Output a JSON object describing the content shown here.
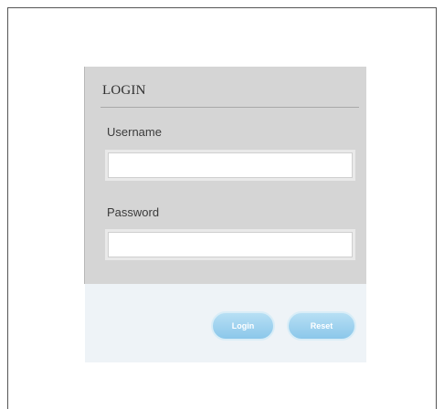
{
  "login": {
    "title": "LOGIN",
    "username_label": "Username",
    "username_value": "",
    "password_label": "Password",
    "password_value": "",
    "login_button": "Login",
    "reset_button": "Reset"
  },
  "colors": {
    "form_background": "#d5d5d5",
    "button_bar_background": "#eef3f7",
    "button": "#9fd3ef"
  }
}
